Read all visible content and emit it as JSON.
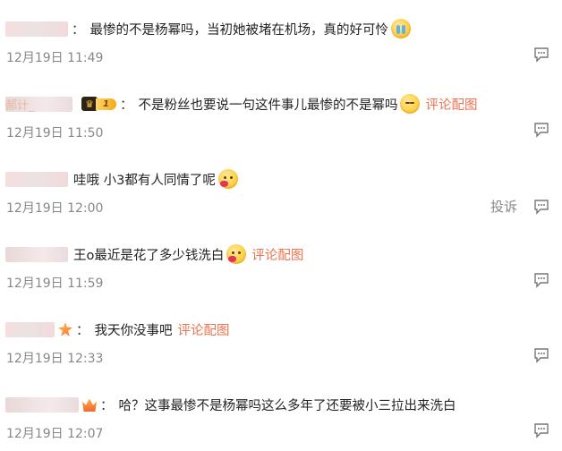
{
  "comments": [
    {
      "text": "最惨的不是杨幂吗，当初她被堵在机场，真的好可怜",
      "time": "12月19日 11:49",
      "emoji": "cry-emoji",
      "link": "",
      "badge": "",
      "report": "",
      "partial_name": ""
    },
    {
      "text": "不是粉丝也要说一句这件事儿最惨的不是幂吗",
      "time": "12月19日 11:50",
      "emoji": "shy-emoji",
      "link": "评论配图",
      "badge": "vip-level",
      "level": "1",
      "report": "",
      "partial_name": "郝计_"
    },
    {
      "text": "哇哦 小3都有人同情了呢",
      "time": "12月19日 12:00",
      "emoji": "kiss-emoji",
      "link": "",
      "badge": "",
      "report": "投诉",
      "partial_name": ""
    },
    {
      "text": "王o最近是花了多少钱洗白",
      "time": "12月19日 11:59",
      "emoji": "kiss-emoji",
      "link": "评论配图",
      "badge": "",
      "report": "",
      "partial_name": ""
    },
    {
      "text": "我天你没事吧",
      "time": "12月19日 12:33",
      "emoji": "",
      "link": "评论配图",
      "badge": "fan-badge",
      "report": "",
      "partial_name": ""
    },
    {
      "text": "哈？这事最惨不是杨幂吗这么多年了还要被小三拉出来洗白",
      "time": "12月19日 12:07",
      "emoji": "",
      "link": "",
      "badge": "crown-badge",
      "report": "",
      "partial_name": ""
    }
  ],
  "icons": {
    "reply": "comment-reply-icon",
    "crown": "crown-icon"
  },
  "colors": {
    "link": "#eb7350",
    "meta": "#888888",
    "text": "#222222"
  }
}
